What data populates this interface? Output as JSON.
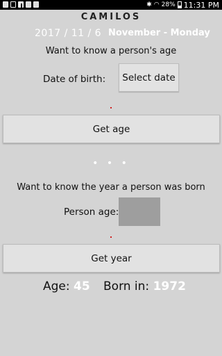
{
  "status_bar": {
    "icons_left": [
      "gallery-icon",
      "image-icon",
      "facebook-icon",
      "photo-icon",
      "photo-icon"
    ],
    "battery": "28%",
    "time": "11:31 PM"
  },
  "app": {
    "title": "CAMILOS",
    "date": "2017 / 11 / 6",
    "month_day": "November - Monday"
  },
  "age_section": {
    "prompt": "Want to know a person's age",
    "dob_label": "Date of birth:",
    "select_date_label": "Select date",
    "get_age_label": "Get age"
  },
  "separator": "• • •",
  "year_section": {
    "prompt": "Want to know the year a person was born",
    "age_label": "Person age:",
    "age_value": "",
    "get_year_label": "Get year"
  },
  "results": {
    "age_label": "Age:",
    "age_value": "45",
    "born_label": "Born in:",
    "born_value": "1972"
  },
  "colors": {
    "background": "#d4d4d4",
    "button": "#e2e2e2",
    "input": "#9e9e9e",
    "accent_text": "#ffffff",
    "dot": "#d02020"
  }
}
